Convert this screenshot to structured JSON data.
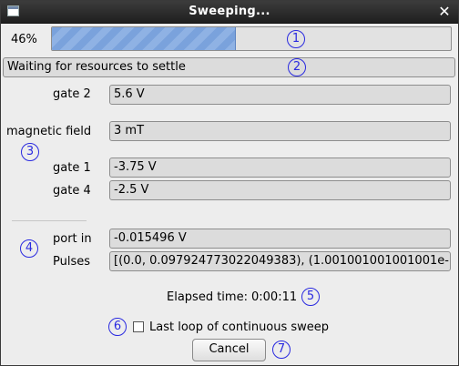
{
  "window": {
    "title": "Sweeping..."
  },
  "progress": {
    "label": "46%",
    "fraction": 0.46
  },
  "status": {
    "text": "Waiting for resources to settle"
  },
  "parameters": [
    {
      "label": "gate 2",
      "value": "5.6 V"
    },
    {
      "label": "magnetic field",
      "value": "3 mT"
    },
    {
      "label": "gate 1",
      "value": "-3.75 V"
    },
    {
      "label": "gate 4",
      "value": "-2.5 V"
    }
  ],
  "measurements": [
    {
      "label": "port in",
      "value": "-0.015496 V"
    },
    {
      "label": "Pulses",
      "value": "[(0.0, 0.097924773022049383), (1.001001001001001e-"
    }
  ],
  "elapsed": {
    "label": "Elapsed time:",
    "value": "0:00:11"
  },
  "last_loop": {
    "label": "Last loop of continuous sweep",
    "checked": false
  },
  "buttons": {
    "cancel": "Cancel"
  },
  "markers": [
    "1",
    "2",
    "3",
    "4",
    "5",
    "6",
    "7"
  ],
  "colors": {
    "accent": "#7aa2dc",
    "marker": "#2a2ae0",
    "titlebar": "#2b2b2b"
  }
}
